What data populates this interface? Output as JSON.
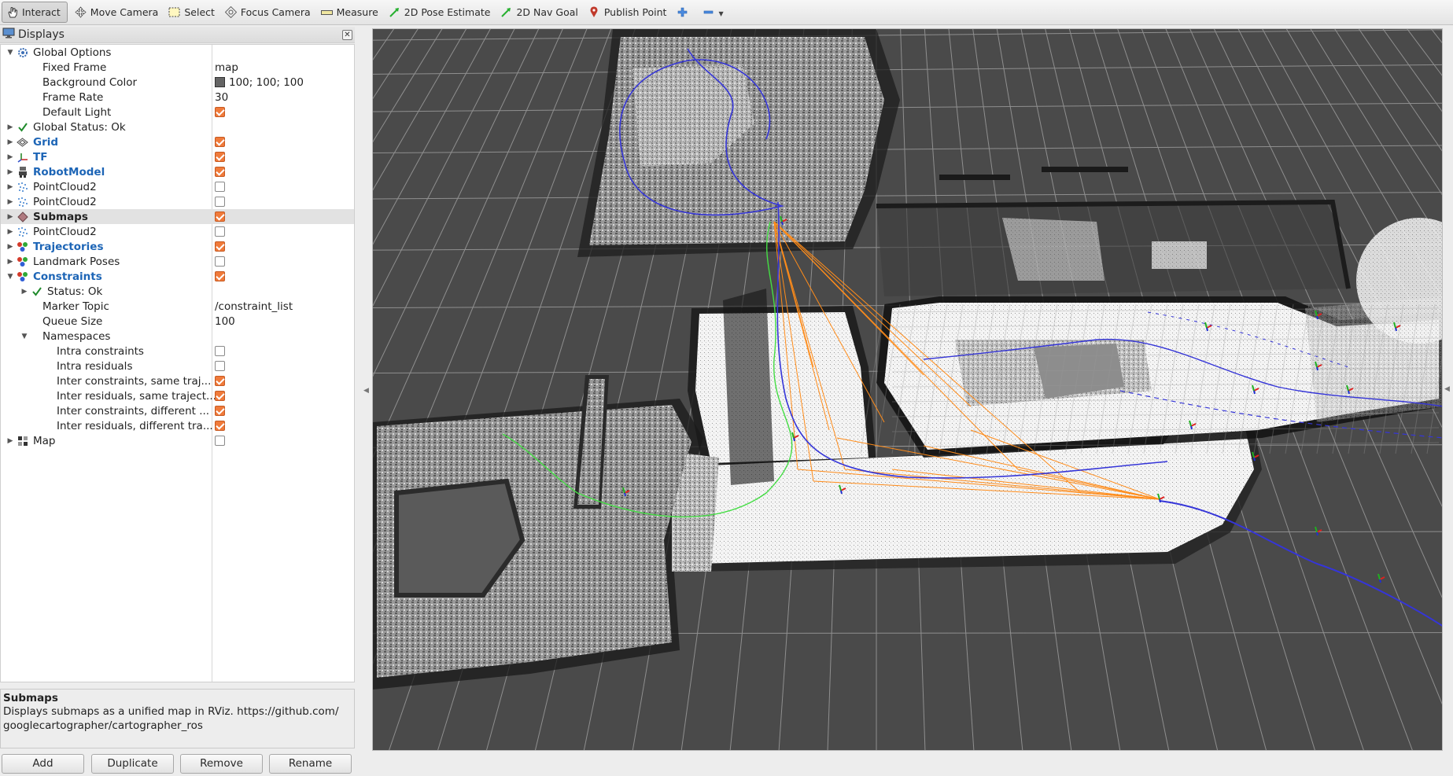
{
  "toolbar": {
    "tools": [
      {
        "label": "Interact",
        "icon": "hand-cursor-icon"
      },
      {
        "label": "Move Camera",
        "icon": "move-arrows-icon"
      },
      {
        "label": "Select",
        "icon": "selection-box-icon"
      },
      {
        "label": "Focus Camera",
        "icon": "focus-target-icon"
      },
      {
        "label": "Measure",
        "icon": "ruler-icon"
      },
      {
        "label": "2D Pose Estimate",
        "icon": "green-arrow-icon"
      },
      {
        "label": "2D Nav Goal",
        "icon": "green-arrow-icon"
      },
      {
        "label": "Publish Point",
        "icon": "map-pin-icon"
      }
    ],
    "add_icon": "plus-icon",
    "remove_icon": "minus-icon"
  },
  "displays_panel": {
    "title": "Displays",
    "tree": [
      {
        "name": "Global Options",
        "value": ""
      },
      {
        "name": "Fixed Frame",
        "value": "map"
      },
      {
        "name": "Background Color",
        "value": "100; 100; 100"
      },
      {
        "name": "Frame Rate",
        "value": "30"
      },
      {
        "name": "Default Light",
        "checked": true
      },
      {
        "name": "Global Status: Ok"
      },
      {
        "name": "Grid",
        "checked": true
      },
      {
        "name": "TF",
        "checked": true
      },
      {
        "name": "RobotModel",
        "checked": true
      },
      {
        "name": "PointCloud2",
        "checked": false
      },
      {
        "name": "PointCloud2",
        "checked": false
      },
      {
        "name": "Submaps",
        "checked": true
      },
      {
        "name": "PointCloud2",
        "checked": false
      },
      {
        "name": "Trajectories",
        "checked": true
      },
      {
        "name": "Landmark Poses",
        "checked": false
      },
      {
        "name": "Constraints",
        "checked": true
      },
      {
        "name": "Status: Ok"
      },
      {
        "name": "Marker Topic",
        "value": "/constraint_list"
      },
      {
        "name": "Queue Size",
        "value": "100"
      },
      {
        "name": "Namespaces"
      },
      {
        "name": "Intra constraints",
        "checked": false
      },
      {
        "name": "Intra residuals",
        "checked": false
      },
      {
        "name": "Inter constraints, same traj...",
        "checked": true
      },
      {
        "name": "Inter residuals, same traject...",
        "checked": true
      },
      {
        "name": "Inter constraints, different ...",
        "checked": true
      },
      {
        "name": "Inter residuals, different tra...",
        "checked": true
      },
      {
        "name": "Map",
        "checked": false
      }
    ]
  },
  "description": {
    "title": "Submaps",
    "text": "Displays submaps as a unified map in RViz. https://github.com/ googlecartographer/cartographer_ros"
  },
  "buttons": {
    "add": "Add",
    "duplicate": "Duplicate",
    "remove": "Remove",
    "rename": "Rename"
  },
  "colors": {
    "background": "#646464",
    "checkbox_checked": "#f07a3a",
    "link_blue": "#1d65b6",
    "trajectory_blue": "#2020e0",
    "constraint_orange": "#ff8c1a",
    "trajectory_green": "#44dd44"
  }
}
